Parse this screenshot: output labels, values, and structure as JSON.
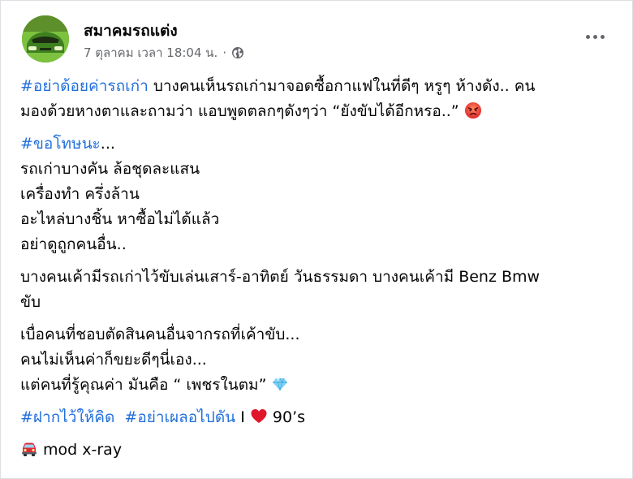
{
  "post": {
    "author": "สมาคมรถแต่ง",
    "timestamp": "7 ตุลาคม เวลา 18:04 น.",
    "separator": "·",
    "privacy_icon": "globe-icon",
    "more_icon": "more-options-icon"
  },
  "content": {
    "p1": {
      "hashtag": "#อย่าด้อยค่ารถเก่า",
      "text_line1": " บางคนเห็นรถเก่ามาจอดซื้อกาแฟในที่ดีๆ หรูๆ ห้างดัง.. คน",
      "text_line2": "มองด้วยหางตาและถามว่า แอบพูดตลกๆดังๆว่า “ยังขับได้อีกหรอ..” ",
      "emoji": "angry-face-emoji"
    },
    "p2": {
      "hashtag": "#ขอโทษนะ",
      "hashtag_suffix": "...",
      "lines": [
        "รถเก่าบางคัน ล้อชุดละแสน",
        "เครื่องทำ ครึ่งล้าน",
        "อะไหล่บางชิ้น หาซื้อไม่ได้แล้ว",
        "อย่าดูถูกคนอื่น.."
      ]
    },
    "p3": {
      "line1": "บางคนเค้ามีรถเก่าไว้ขับเล่นเสาร์-อาทิตย์ วันธรรมดา บางคนเค้ามี Benz Bmw",
      "line2": "ขับ"
    },
    "p4": {
      "line1": "เบื่อคนที่ชอบตัดสินคนอื่นจากรถที่เค้าขับ...",
      "line2": "คนไม่เห็นค่าก็ขยะดีๆนี่เอง...",
      "line3": "แต่คนที่รู้คุณค่า มันคือ “ เพชรในตม” ",
      "emoji": "gem-emoji"
    },
    "p5": {
      "hashtag1": "#ฝากไว้ให้คิด",
      "hashtag2": "#อย่าเผลอไปดัน",
      "text_before_heart": " I ",
      "heart_icon": "red-heart-emoji",
      "text_after_heart": " 90’s"
    },
    "p6": {
      "car_icon": "car-emoji",
      "text": " mod x-ray"
    }
  },
  "colors": {
    "hashtag": "#216fdb",
    "meta": "#65676b",
    "text": "#050505"
  }
}
